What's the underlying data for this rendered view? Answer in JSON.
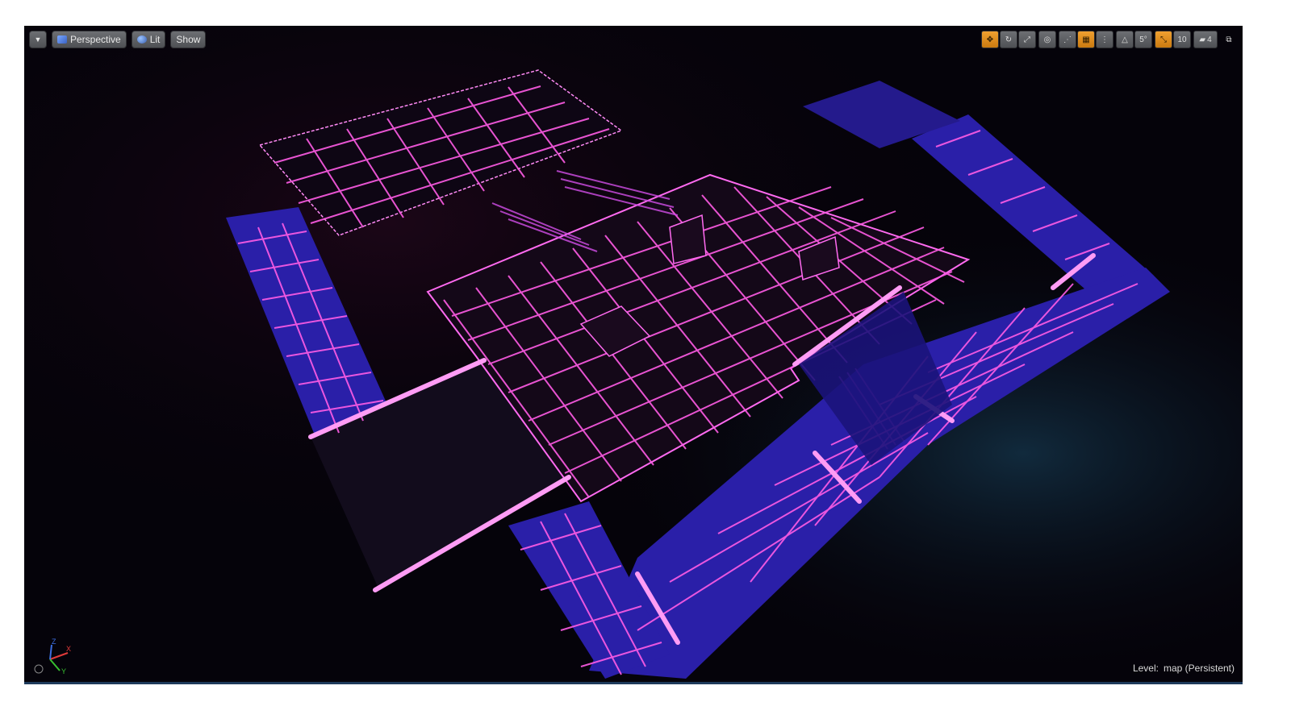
{
  "viewport": {
    "view_mode": "Perspective",
    "lighting_mode": "Lit",
    "show_label": "Show",
    "level_prefix": "Level:",
    "level_name": "map (Persistent)"
  },
  "right_toolbar": {
    "rotation_snap": "5°",
    "grid_snap": "10",
    "camera_speed": "4"
  },
  "icons": {
    "dropdown": "chevron-down-icon",
    "perspective": "perspective-cube-icon",
    "lit": "lit-sphere-icon",
    "translate": "translate-icon",
    "rotate": "rotate-icon",
    "scale": "scale-icon",
    "world": "world-local-icon",
    "surface_snap": "surface-snap-icon",
    "grid": "grid-snap-icon",
    "rotation": "rotation-snap-icon",
    "scale_snap": "scale-snap-icon",
    "camera": "camera-speed-icon",
    "maximize": "maximize-icon"
  },
  "colors": {
    "neon_pink": "#ff5ce6",
    "floor_blue": "#2a1fa8",
    "space_bg": "#05030a",
    "accent_orange": "#e8951f"
  }
}
